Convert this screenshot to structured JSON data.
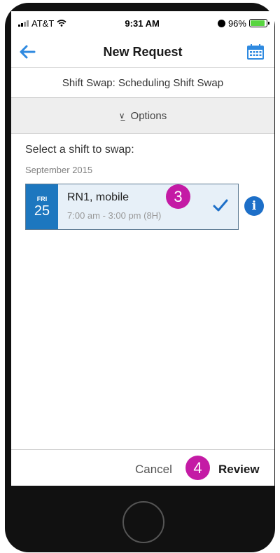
{
  "status_bar": {
    "carrier": "AT&T",
    "time": "9:31 AM",
    "battery": "96%"
  },
  "nav": {
    "title": "New Request",
    "back_icon": "back-arrow-icon",
    "calendar_icon": "calendar-icon"
  },
  "subheader": {
    "text": "Shift Swap: Scheduling Shift Swap"
  },
  "options": {
    "label": "Options",
    "icon": "double-chevron-down-icon"
  },
  "content": {
    "prompt": "Select a shift to swap:",
    "month": "September 2015",
    "shift": {
      "day_of_week": "FRI",
      "day": "25",
      "title": "RN1, mobile",
      "time_range": "7:00 am - 3:00 pm (8H)",
      "selected": true
    }
  },
  "annotations": {
    "step3": "3",
    "step4": "4"
  },
  "footer": {
    "cancel_label": "Cancel",
    "review_label": "Review"
  },
  "colors": {
    "accent": "#1d77bf",
    "badge": "#c41ba5",
    "selected_bg": "#e7f0f8",
    "battery": "#57d53f"
  }
}
